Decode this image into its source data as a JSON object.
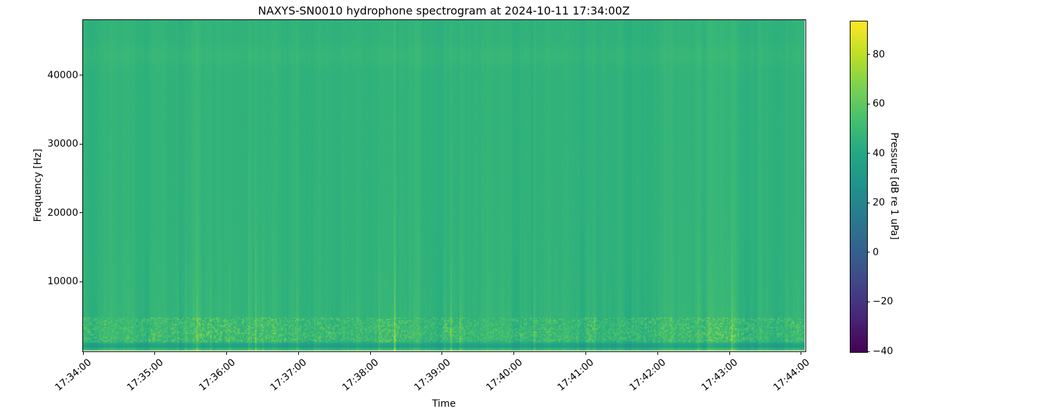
{
  "title": "NAXYS-SN0010 hydrophone spectrogram at 2024-10-11 17:34:00Z",
  "axes": {
    "xlabel": "Time",
    "ylabel": "Frequency [Hz]",
    "x_tick_labels": [
      "17:34:00",
      "17:35:00",
      "17:36:00",
      "17:37:00",
      "17:38:00",
      "17:39:00",
      "17:40:00",
      "17:41:00",
      "17:42:00",
      "17:43:00",
      "17:44:00"
    ],
    "y_tick_labels": [
      "10000",
      "20000",
      "30000",
      "40000"
    ],
    "y_tick_values": [
      10000,
      20000,
      30000,
      40000
    ]
  },
  "colorbar": {
    "label": "Pressure [dB re 1 uPa]",
    "tick_labels": [
      "80",
      "60",
      "40",
      "20",
      "0",
      "−20",
      "−40"
    ],
    "tick_values": [
      80,
      60,
      40,
      20,
      0,
      -20,
      -40
    ],
    "vmin": -40,
    "vmax": 93.7,
    "colormap": "viridis",
    "colors": [
      "#440154",
      "#482475",
      "#414487",
      "#355f8d",
      "#2a788e",
      "#21918c",
      "#22a884",
      "#44bf70",
      "#7ad151",
      "#bddf26",
      "#fde725"
    ]
  },
  "chart_data": {
    "type": "heatmap",
    "subtype": "spectrogram",
    "title": "NAXYS-SN0010 hydrophone spectrogram at 2024-10-11 17:34:00Z",
    "xlabel": "Time",
    "ylabel": "Frequency [Hz]",
    "x_start": "17:34:00",
    "x_end": "17:44:03",
    "duration_s": 603,
    "x_tick_interval_s": 60,
    "ylim": [
      0,
      48000
    ],
    "y_ticks": [
      10000,
      20000,
      30000,
      40000
    ],
    "value_label": "Pressure [dB re 1 uPa]",
    "vmin": -40,
    "vmax": 93.7,
    "colormap": "viridis",
    "grid": false,
    "legend": "colorbar-right",
    "levels": {
      "background_db": 46.3,
      "column_striation_db": 2.5,
      "transient_click_db": 9,
      "low_freq_boost_scale_hz": 8200,
      "speckle_band_hz": [
        1200,
        4800
      ],
      "speckle_band_peak_db": 66,
      "quiet_dip_center_hz": 700,
      "quiet_dip_sigma_hz": 320,
      "quiet_dip_depth_db": 12.3,
      "bottom_line_hz": [
        0,
        330
      ],
      "bottom_line_db": 58,
      "faint_band_center_hz": 42800,
      "faint_band_sigma_hz": 1100,
      "faint_band_boost_db": 1.7
    }
  }
}
